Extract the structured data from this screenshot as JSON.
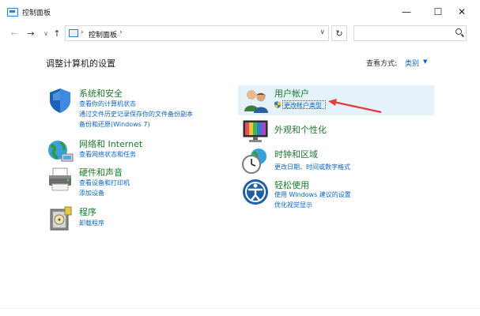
{
  "window": {
    "title": "控制面板",
    "minimize_glyph": "—",
    "maximize_glyph": "☐",
    "close_glyph": "✕"
  },
  "nav": {
    "back_glyph": "←",
    "forward_glyph": "→",
    "history_glyph": "∨",
    "up_glyph": "↑",
    "refresh_glyph": "↻"
  },
  "address": {
    "separator": "›",
    "crumb": "控制面板",
    "dropdown_glyph": "∨"
  },
  "search": {
    "placeholder": ""
  },
  "page": {
    "title": "调整计算机的设置",
    "view_by_label": "查看方式:",
    "view_by_value": "类别",
    "view_by_caret": "▼"
  },
  "categories": [
    {
      "id": "system-security",
      "title": "系统和安全",
      "icon": "shield-icon",
      "links": [
        "查看你的计算机状态",
        "通过文件历史记录保存你的文件备份副本",
        "备份和还原(Windows 7)"
      ]
    },
    {
      "id": "network-internet",
      "title": "网络和 Internet",
      "icon": "globe-network-icon",
      "links": [
        "查看网络状态和任务"
      ]
    },
    {
      "id": "hardware-sound",
      "title": "硬件和声音",
      "icon": "printer-icon",
      "links": [
        "查看设备和打印机",
        "添加设备"
      ]
    },
    {
      "id": "programs",
      "title": "程序",
      "icon": "program-disk-icon",
      "links": [
        "卸载程序"
      ]
    },
    {
      "id": "user-accounts",
      "title": "用户帐户",
      "icon": "users-icon",
      "links": [
        "更改帐户类型"
      ]
    },
    {
      "id": "appearance",
      "title": "外观和个性化",
      "icon": "monitor-palette-icon",
      "links": []
    },
    {
      "id": "clock-region",
      "title": "时钟和区域",
      "icon": "clock-globe-icon",
      "links": [
        "更改日期、时间或数字格式"
      ]
    },
    {
      "id": "ease-of-access",
      "title": "轻松使用",
      "icon": "accessibility-icon",
      "links": [
        "使用 Windows 建议的设置",
        "优化视觉显示"
      ]
    }
  ],
  "annotation": {
    "arrow_color": "#e23b3b"
  }
}
